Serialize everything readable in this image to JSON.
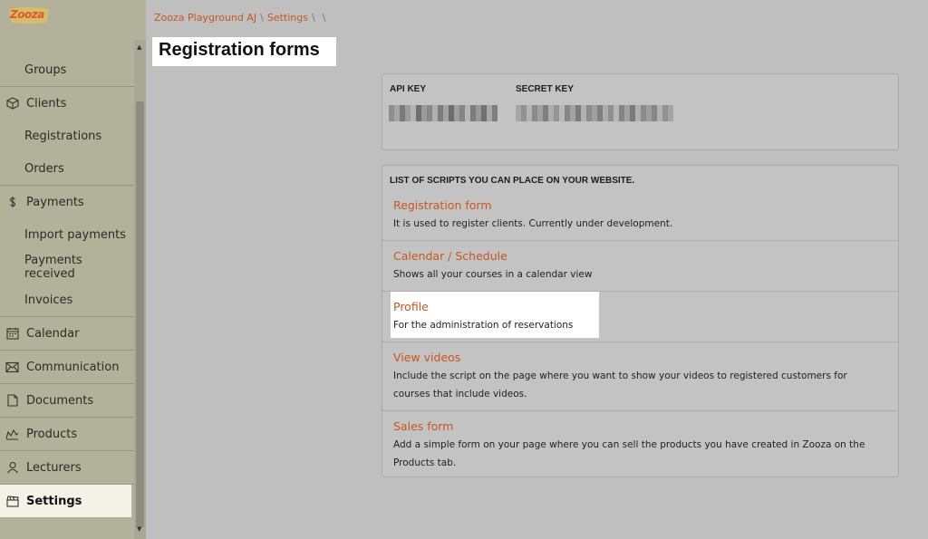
{
  "app": {
    "logo_text": "Zooza"
  },
  "sidebar": {
    "items": [
      {
        "label": "Groups",
        "icon": "",
        "kind": "sub"
      },
      {
        "label": "Clients",
        "icon": "box-icon",
        "kind": "top"
      },
      {
        "label": "Registrations",
        "icon": "",
        "kind": "sub"
      },
      {
        "label": "Orders",
        "icon": "",
        "kind": "sub"
      },
      {
        "label": "Payments",
        "icon": "dollar-icon",
        "kind": "top"
      },
      {
        "label": "Import payments",
        "icon": "",
        "kind": "sub"
      },
      {
        "label": "Payments received",
        "icon": "",
        "kind": "sub"
      },
      {
        "label": "Invoices",
        "icon": "",
        "kind": "sub"
      },
      {
        "label": "Calendar",
        "icon": "calendar-icon",
        "kind": "top"
      },
      {
        "label": "Communication",
        "icon": "envelope-icon",
        "kind": "top"
      },
      {
        "label": "Documents",
        "icon": "document-icon",
        "kind": "top"
      },
      {
        "label": "Products",
        "icon": "products-icon",
        "kind": "top"
      },
      {
        "label": "Lecturers",
        "icon": "person-icon",
        "kind": "top"
      },
      {
        "label": "Settings",
        "icon": "clapperboard-icon",
        "kind": "top",
        "active": true
      }
    ]
  },
  "breadcrumb": {
    "items": [
      "Zooza Playground AJ",
      "Settings",
      ""
    ]
  },
  "page": {
    "title": "Registration forms"
  },
  "keys": {
    "api_label": "API KEY",
    "secret_label": "SECRET KEY"
  },
  "scripts": {
    "heading": "LIST OF SCRIPTS YOU CAN PLACE ON YOUR WEBSITE.",
    "items": [
      {
        "title": "Registration form",
        "description": "It is used to register clients. Currently under development."
      },
      {
        "title": "Calendar / Schedule",
        "description": "Shows all your courses in a calendar view"
      },
      {
        "title": "Profile",
        "description": "For the administration of reservations"
      },
      {
        "title": "View videos",
        "description": "Include the script on the page where you want to show your videos to registered customers for courses that include videos."
      },
      {
        "title": "Sales form",
        "description": "Add a simple form on your page where you can sell the products you have created in Zooza on the Products tab."
      }
    ]
  },
  "colors": {
    "accent": "#c9561e",
    "sidebar_bg": "#b2b29a",
    "main_bg": "#bfbfbf"
  }
}
